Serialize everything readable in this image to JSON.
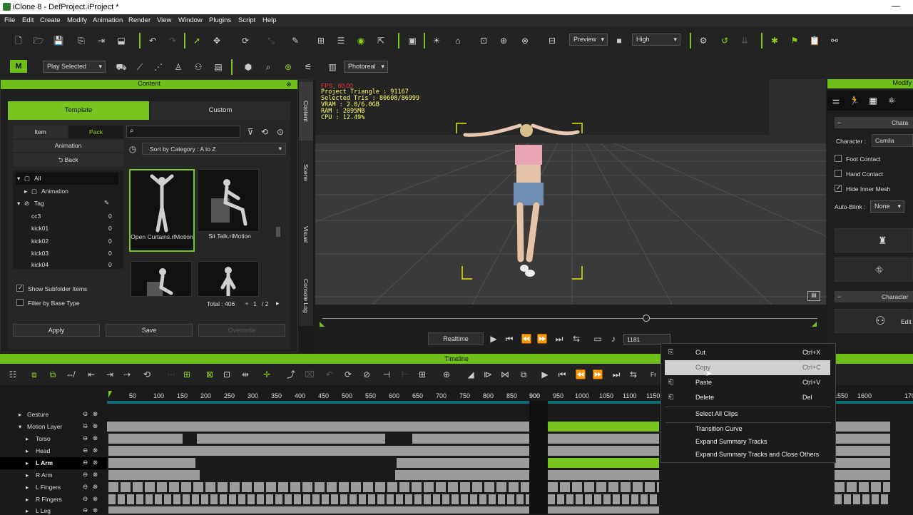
{
  "window": {
    "title": "iClone 8 - DefProject.iProject *",
    "minimize": "—"
  },
  "menu": [
    "File",
    "Edit",
    "Create",
    "Modify",
    "Animation",
    "Render",
    "View",
    "Window",
    "Plugins",
    "Script",
    "Help"
  ],
  "toolbar1": {
    "preview": "Preview",
    "quality": "High"
  },
  "toolbar2": {
    "play_mode": "Play Selected",
    "render_mode": "Photoreal",
    "logo": "M"
  },
  "content": {
    "header": "Content",
    "tabs": [
      "Template",
      "Custom"
    ],
    "subtabs": [
      "Item",
      "Pack"
    ],
    "animation_btn": "Animation",
    "back_btn": "Back",
    "sort": "Sort by Category : A to Z",
    "tree": [
      {
        "label": "All",
        "count": ""
      },
      {
        "label": "Animation",
        "count": ""
      },
      {
        "label": "Tag",
        "count": ""
      },
      {
        "label": "cc3",
        "count": "0"
      },
      {
        "label": "kick01",
        "count": "0"
      },
      {
        "label": "kick02",
        "count": "0"
      },
      {
        "label": "kick03",
        "count": "0"
      },
      {
        "label": "kick04",
        "count": "0"
      }
    ],
    "thumbs": [
      "Open Curtains.rlMotion",
      "Sit Talk.rlMotion"
    ],
    "show_subfolder": "Show Subfolder Items",
    "filter_base": "Filter by Base Type",
    "total": "Total : 406",
    "page": "1",
    "of": "/ 2",
    "apply": "Apply",
    "save": "Save",
    "overwrite": "Overwrite"
  },
  "side_tabs": [
    "Content",
    "Scene",
    "Visual",
    "Console Log"
  ],
  "viewport": {
    "fps": "FPS : 60.00",
    "stats": [
      "Project Triangle : 91167",
      "Selected Tris : 80608/86999",
      "VRAM : 2.0/6.0GB",
      "RAM : 2095MB",
      "CPU : 12.49%"
    ],
    "realtime": "Realtime",
    "frame": "1181"
  },
  "modify": {
    "header": "Modify",
    "section1": "Chara",
    "character_label": "Character :",
    "character_value": "Camila",
    "foot_contact": "Foot Contact",
    "hand_contact": "Hand Contact",
    "hide_mesh": "Hide Inner Mesh",
    "autoblink_label": "Auto-Blink :",
    "autoblink_value": "None",
    "section2": "Character",
    "edit": "Edit"
  },
  "timeline": {
    "header": "Timeline",
    "ticks": [
      "50",
      "100",
      "150",
      "200",
      "250",
      "300",
      "350",
      "400",
      "450",
      "500",
      "550",
      "600",
      "650",
      "700",
      "750",
      "800",
      "850",
      "900",
      "950",
      "1000",
      "1050",
      "1100",
      "1150",
      "1550",
      "1600",
      "170"
    ],
    "fr": "Fr",
    "tracks": [
      {
        "name": "Gesture"
      },
      {
        "name": "Motion Layer"
      },
      {
        "name": "Torso"
      },
      {
        "name": "Head"
      },
      {
        "name": "L Arm"
      },
      {
        "name": "R Arm"
      },
      {
        "name": "L Fingers"
      },
      {
        "name": "R Fingers"
      },
      {
        "name": "L Leg"
      }
    ]
  },
  "context_menu": [
    {
      "label": "Cut",
      "key": "Ctrl+X"
    },
    {
      "label": "Copy",
      "key": "Ctrl+C"
    },
    {
      "label": "Paste",
      "key": "Ctrl+V"
    },
    {
      "label": "Delete",
      "key": "Del"
    },
    {
      "label": "Select All Clips",
      "key": ""
    },
    {
      "label": "Transition Curve",
      "key": ""
    },
    {
      "label": "Expand Summary Tracks",
      "key": ""
    },
    {
      "label": "Expand Summary Tracks and Close Others",
      "key": ""
    }
  ],
  "colors": {
    "accent": "#7ac41f",
    "bg": "#1c1c1c",
    "menu_bg": "#2b2b2b",
    "clip": "#9c9c9c",
    "viewport_stats": "#ffff66",
    "fps": "#ff3333"
  }
}
